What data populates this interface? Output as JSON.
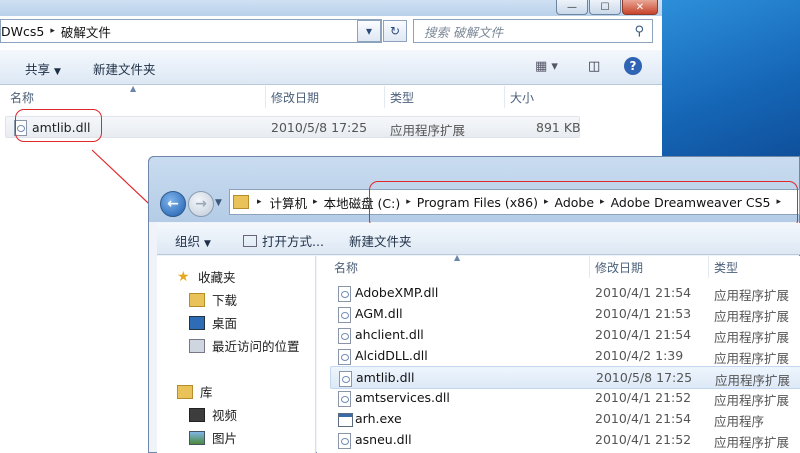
{
  "back_window": {
    "breadcrumb": [
      "DWcs5",
      "破解文件"
    ],
    "search_placeholder": "搜索 破解文件",
    "toolbar": {
      "share": "共享",
      "new_folder": "新建文件夹"
    },
    "columns": [
      "名称",
      "修改日期",
      "类型",
      "大小"
    ],
    "files": [
      {
        "name": "amtlib.dll",
        "date": "2010/5/8 17:25",
        "type": "应用程序扩展",
        "size": "891 KB"
      }
    ],
    "caption_buttons": {
      "minimize": "—",
      "maximize": "☐",
      "close": "✕"
    }
  },
  "front_window": {
    "breadcrumb": [
      "计算机",
      "本地磁盘 (C:)",
      "Program Files (x86)",
      "Adobe",
      "Adobe Dreamweaver CS5"
    ],
    "toolbar": {
      "organize": "组织",
      "open_with": "打开方式...",
      "new_folder": "新建文件夹"
    },
    "nav": [
      {
        "label": "收藏夹",
        "icon": "star-icon"
      },
      {
        "label": "下载",
        "icon": "download-folder-icon"
      },
      {
        "label": "桌面",
        "icon": "desktop-icon"
      },
      {
        "label": "最近访问的位置",
        "icon": "recent-places-icon"
      },
      {
        "label": "库",
        "icon": "library-icon"
      },
      {
        "label": "视频",
        "icon": "videos-icon"
      },
      {
        "label": "图片",
        "icon": "pictures-icon"
      }
    ],
    "columns": [
      "名称",
      "修改日期",
      "类型"
    ],
    "files": [
      {
        "name": "AdobeXMP.dll",
        "date": "2010/4/1 21:54",
        "type": "应用程序扩展",
        "icon": "dll-file-icon"
      },
      {
        "name": "AGM.dll",
        "date": "2010/4/1 21:53",
        "type": "应用程序扩展",
        "icon": "dll-file-icon"
      },
      {
        "name": "ahclient.dll",
        "date": "2010/4/1 21:54",
        "type": "应用程序扩展",
        "icon": "dll-file-icon"
      },
      {
        "name": "AlcidDLL.dll",
        "date": "2010/4/2 1:39",
        "type": "应用程序扩展",
        "icon": "dll-file-icon"
      },
      {
        "name": "amtlib.dll",
        "date": "2010/5/8 17:25",
        "type": "应用程序扩展",
        "icon": "dll-file-icon"
      },
      {
        "name": "amtservices.dll",
        "date": "2010/4/1 21:52",
        "type": "应用程序扩展",
        "icon": "dll-file-icon"
      },
      {
        "name": "arh.exe",
        "date": "2010/4/1 21:54",
        "type": "应用程序",
        "icon": "exe-file-icon"
      },
      {
        "name": "asneu.dll",
        "date": "2010/4/1 21:52",
        "type": "应用程序扩展",
        "icon": "dll-file-icon"
      }
    ],
    "selected_file": "amtlib.dll"
  },
  "colors": {
    "annotation_red": "#e0282a",
    "selection_blue": "#dde9f7"
  }
}
